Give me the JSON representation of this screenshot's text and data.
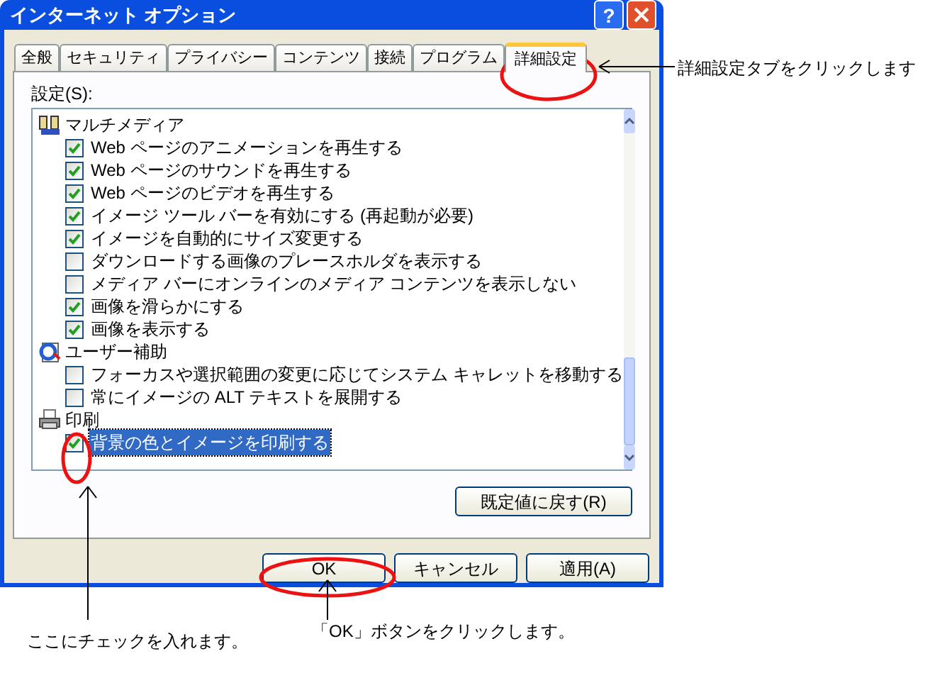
{
  "window": {
    "title": "インターネット オプション",
    "help_button": "?"
  },
  "tabs": [
    {
      "label": "全般",
      "selected": false
    },
    {
      "label": "セキュリティ",
      "selected": false
    },
    {
      "label": "プライバシー",
      "selected": false
    },
    {
      "label": "コンテンツ",
      "selected": false
    },
    {
      "label": "接続",
      "selected": false
    },
    {
      "label": "プログラム",
      "selected": false
    },
    {
      "label": "詳細設定",
      "selected": true
    }
  ],
  "settings_label": "設定(S):",
  "settings": [
    {
      "label": "マルチメディア",
      "kind": "multimedia",
      "children": [
        {
          "label": "Web ページのアニメーションを再生する",
          "checked": true,
          "selected": false
        },
        {
          "label": "Web ページのサウンドを再生する",
          "checked": true,
          "selected": false
        },
        {
          "label": "Web ページのビデオを再生する",
          "checked": true,
          "selected": false
        },
        {
          "label": "イメージ ツール バーを有効にする (再起動が必要)",
          "checked": true,
          "selected": false
        },
        {
          "label": "イメージを自動的にサイズ変更する",
          "checked": true,
          "selected": false
        },
        {
          "label": "ダウンロードする画像のプレースホルダを表示する",
          "checked": false,
          "selected": false
        },
        {
          "label": "メディア バーにオンラインのメディア コンテンツを表示しない",
          "checked": false,
          "selected": false
        },
        {
          "label": "画像を滑らかにする",
          "checked": true,
          "selected": false
        },
        {
          "label": "画像を表示する",
          "checked": true,
          "selected": false
        }
      ]
    },
    {
      "label": "ユーザー補助",
      "kind": "accessibility",
      "children": [
        {
          "label": "フォーカスや選択範囲の変更に応じてシステム キャレットを移動する",
          "checked": false,
          "selected": false
        },
        {
          "label": "常にイメージの ALT テキストを展開する",
          "checked": false,
          "selected": false
        }
      ]
    },
    {
      "label": "印刷",
      "kind": "printing",
      "children": [
        {
          "label": "背景の色とイメージを印刷する",
          "checked": true,
          "selected": true
        }
      ]
    }
  ],
  "restore_button": "既定値に戻す(R)",
  "buttons": [
    "OK",
    "キャンセル",
    "適用(A)"
  ],
  "annotations": [
    "詳細設定タブをクリックします",
    "ここにチェックを入れます。",
    "「OK」ボタンをクリックします。"
  ]
}
